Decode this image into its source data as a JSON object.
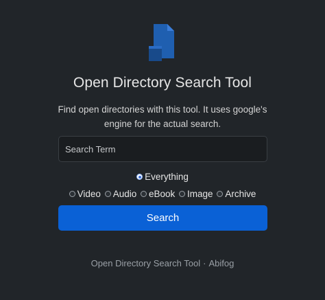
{
  "app": {
    "logo_icon": "document-icon",
    "accent_color": "#0a61d6",
    "title": "Open Directory Search Tool",
    "subtitle": "Find open directories with this tool. It uses google's engine for the actual search."
  },
  "search": {
    "placeholder": "Search Term",
    "value": "",
    "button_label": "Search"
  },
  "filters": {
    "selected": "Everything",
    "options": [
      {
        "label": "Everything",
        "checked": true
      },
      {
        "label": "Video",
        "checked": false
      },
      {
        "label": "Audio",
        "checked": false
      },
      {
        "label": "eBook",
        "checked": false
      },
      {
        "label": "Image",
        "checked": false
      },
      {
        "label": "Archive",
        "checked": false
      }
    ]
  },
  "footer": {
    "name": "Open Directory Search Tool",
    "separator": "·",
    "author": "Abifog"
  }
}
